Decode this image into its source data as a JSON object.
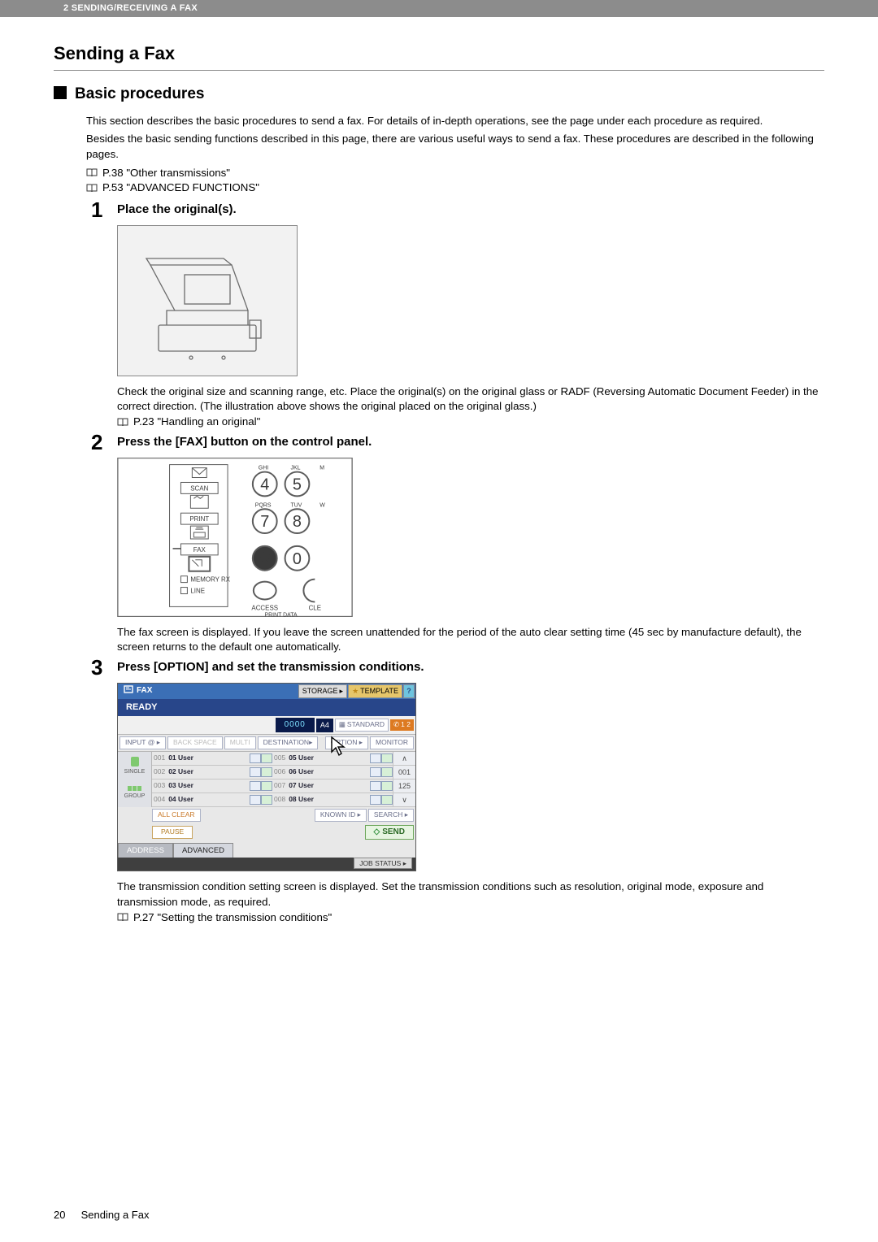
{
  "header": {
    "breadcrumb": "2 SENDING/RECEIVING A FAX"
  },
  "title": "Sending a Fax",
  "subtitle": "Basic procedures",
  "intro": {
    "p1": "This section describes the basic procedures to send a fax. For details of in-depth operations, see the page under each procedure as required.",
    "p2": "Besides the basic sending functions described in this page, there are various useful ways to send a fax. These procedures are described in the following pages."
  },
  "refs": {
    "r1": "P.38 \"Other transmissions\"",
    "r2": "P.53 \"ADVANCED FUNCTIONS\""
  },
  "steps": {
    "s1": {
      "num": "1",
      "title": "Place the original(s).",
      "body": "Check the original size and scanning range, etc. Place the original(s) on the original glass or RADF (Reversing Automatic Document Feeder) in the correct direction. (The illustration above shows the original placed on the original glass.)",
      "ref": "P.23 \"Handling an original\""
    },
    "s2": {
      "num": "2",
      "title": "Press the [FAX] button on the control panel.",
      "panel": {
        "scan": "SCAN",
        "print": "PRINT",
        "fax": "FAX",
        "memory_rx": "MEMORY RX",
        "line": "LINE",
        "access": "ACCESS",
        "cle": "CLE",
        "print_data": "PRINT DATA",
        "row1": {
          "ghi": "GHI",
          "jkl": "JKL",
          "m": "M",
          "k4": "4",
          "k5": "5"
        },
        "row2": {
          "pqrs": "PQRS",
          "tuv": "TUV",
          "w": "W",
          "k7": "7",
          "k8": "8"
        },
        "row3": {
          "kstar": "✱",
          "k0": "0"
        }
      },
      "body": "The fax screen is displayed. If you leave the screen unattended for the period of the auto clear setting time (45 sec by manufacture default), the screen returns to the default one automatically."
    },
    "s3": {
      "num": "3",
      "title": "Press [OPTION] and set the transmission conditions.",
      "body": "The transmission condition setting screen is displayed. Set the transmission conditions such as resolution, original mode, exposure and transmission mode, as required.",
      "ref": "P.27 \"Setting the transmission conditions\""
    }
  },
  "fax_screen": {
    "title": "FAX",
    "top": {
      "storage": "STORAGE",
      "template": "TEMPLATE",
      "help": "?"
    },
    "ready": "READY",
    "dest_num": "0000",
    "dest_fmt": "A4",
    "standard": "STANDARD",
    "lines": "1   2",
    "row2": {
      "input": "INPUT @",
      "back": "BACK SPACE",
      "multi": "MULTI",
      "destination": "DESTINATION",
      "option": "OPTION",
      "monitor": "MONITOR"
    },
    "left": {
      "single": "SINGLE",
      "group": "GROUP"
    },
    "rows": [
      {
        "l_num": "001",
        "l_name": "01 User",
        "r_num": "005",
        "r_name": "05 User"
      },
      {
        "l_num": "002",
        "l_name": "02 User",
        "r_num": "006",
        "r_name": "06 User"
      },
      {
        "l_num": "003",
        "l_name": "03 User",
        "r_num": "007",
        "r_name": "07 User"
      },
      {
        "l_num": "004",
        "l_name": "04 User",
        "r_num": "008",
        "r_name": "08 User"
      }
    ],
    "scroll": {
      "up": "∧",
      "p1": "001",
      "p2": "125",
      "down": "∨"
    },
    "below": {
      "all_clear": "ALL CLEAR",
      "known_id": "KNOWN ID",
      "search": "SEARCH"
    },
    "pause": "PAUSE",
    "send": "SEND",
    "tabs": {
      "address": "ADDRESS",
      "advanced": "ADVANCED"
    },
    "job_status": "JOB STATUS"
  },
  "footer": {
    "page": "20",
    "title": "Sending a Fax"
  }
}
